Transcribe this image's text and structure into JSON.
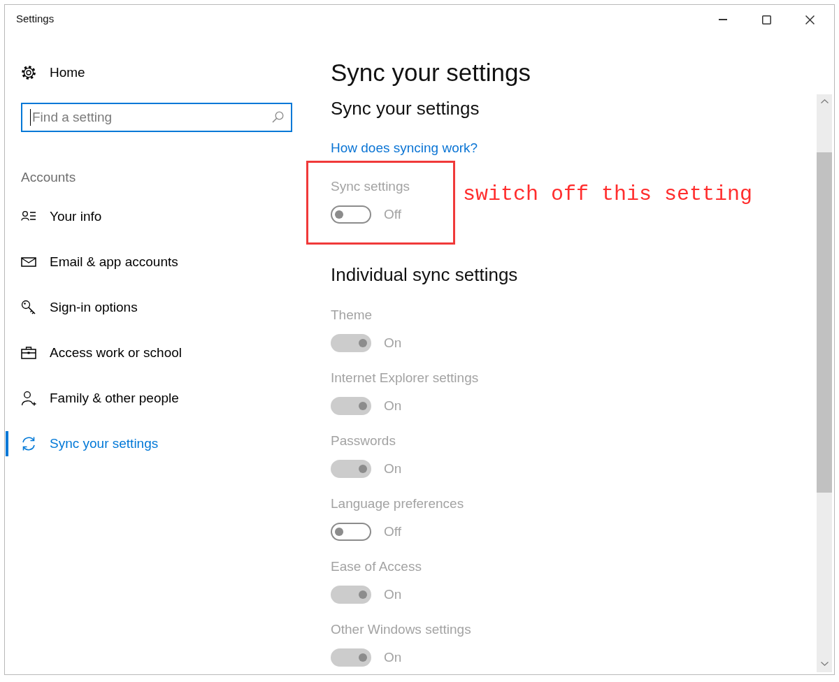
{
  "window": {
    "title": "Settings"
  },
  "sidebar": {
    "home": {
      "label": "Home"
    },
    "search": {
      "placeholder": "Find a setting",
      "focused": true
    },
    "section": "Accounts",
    "items": [
      {
        "label": "Your info",
        "selected": false
      },
      {
        "label": "Email & app accounts",
        "selected": false
      },
      {
        "label": "Sign-in options",
        "selected": false
      },
      {
        "label": "Access work or school",
        "selected": false
      },
      {
        "label": "Family & other people",
        "selected": false
      },
      {
        "label": "Sync your settings",
        "selected": true
      }
    ]
  },
  "main": {
    "title": "Sync your settings",
    "subtitle": "Sync your settings",
    "link": "How does syncing work?",
    "master": {
      "label": "Sync settings",
      "on": false,
      "disabled": true,
      "state_text": "Off"
    },
    "annotation": {
      "text": "switch off this setting"
    },
    "section_heading": "Individual sync settings",
    "items": [
      {
        "label": "Theme",
        "on": true,
        "disabled": true,
        "state_text": "On"
      },
      {
        "label": "Internet Explorer settings",
        "on": true,
        "disabled": true,
        "state_text": "On"
      },
      {
        "label": "Passwords",
        "on": true,
        "disabled": true,
        "state_text": "On"
      },
      {
        "label": "Language preferences",
        "on": false,
        "disabled": true,
        "state_text": "Off"
      },
      {
        "label": "Ease of Access",
        "on": true,
        "disabled": true,
        "state_text": "On"
      },
      {
        "label": "Other Windows settings",
        "on": true,
        "disabled": true,
        "state_text": "On"
      }
    ]
  }
}
